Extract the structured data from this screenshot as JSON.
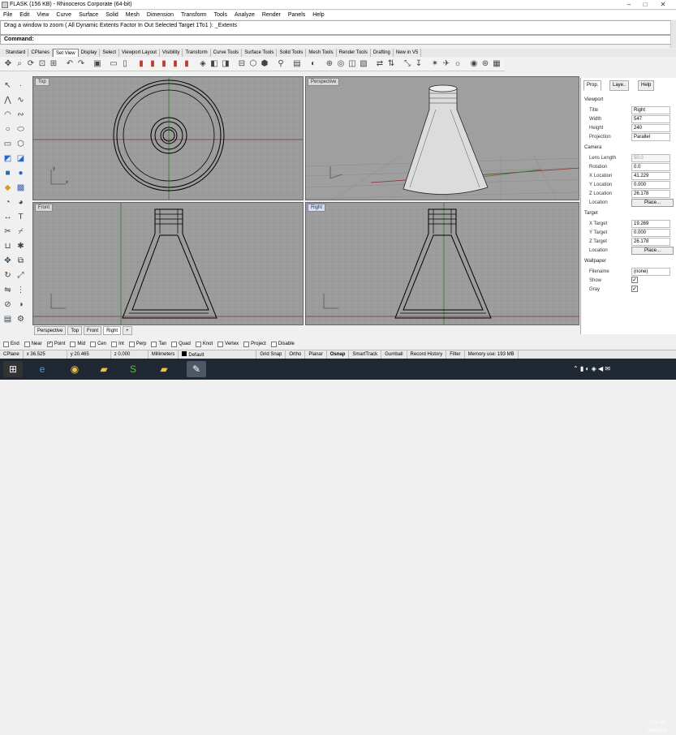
{
  "window": {
    "title": "FLASK (156 KB) - Rhinoceros Corporate (64-bit)"
  },
  "menu": [
    "File",
    "Edit",
    "View",
    "Curve",
    "Surface",
    "Solid",
    "Mesh",
    "Dimension",
    "Transform",
    "Tools",
    "Analyze",
    "Render",
    "Panels",
    "Help"
  ],
  "command": {
    "history": "Drag a window to zoom ( All  Dynamic  Extents  Factor  In  Out  Selected  Target  1To1 ): _Extents",
    "prompt": "Command:"
  },
  "toolbar_tabs": [
    "Standard",
    "CPlanes",
    "Set View",
    "Display",
    "Select",
    "Viewport Layout",
    "Visibility",
    "Transform",
    "Curve Tools",
    "Surface Tools",
    "Solid Tools",
    "Mesh Tools",
    "Render Tools",
    "Drafting",
    "New in V5"
  ],
  "active_toolbar_tab": "Set View",
  "viewports": {
    "top": "Top",
    "perspective": "Perspective",
    "front": "Front",
    "right": "Right"
  },
  "viewport_tabs": [
    "Perspective",
    "Top",
    "Front",
    "Right"
  ],
  "active_viewport_tab": "Right",
  "panel": {
    "tabs": [
      "Prop.",
      "Laye..",
      "Help"
    ],
    "section_viewport": "Viewport",
    "title_label": "Title",
    "title_value": "Right",
    "width_label": "Width",
    "width_value": "547",
    "height_label": "Height",
    "height_value": "240",
    "projection_label": "Projection",
    "projection_value": "Parallel",
    "section_camera": "Camera",
    "lens_label": "Lens Length",
    "lens_value": "50.0",
    "rotation_label": "Rotation",
    "rotation_value": "0.0",
    "xloc_label": "X Location",
    "xloc_value": "41.229",
    "yloc_label": "Y Location",
    "yloc_value": "0.000",
    "zloc_label": "Z Location",
    "zloc_value": "26.178",
    "location_label": "Location",
    "place_label": "Place...",
    "section_target": "Target",
    "xt_label": "X Target",
    "xt_value": "19.269",
    "yt_label": "Y Target",
    "yt_value": "0.000",
    "zt_label": "Z Target",
    "zt_value": "26.178",
    "tlocation_label": "Location",
    "tplace_label": "Place...",
    "section_wallpaper": "Wallpaper",
    "filename_label": "Filename",
    "filename_value": "(none)",
    "show_label": "Show",
    "gray_label": "Gray"
  },
  "osnaps": [
    {
      "label": "End",
      "checked": false
    },
    {
      "label": "Near",
      "checked": false
    },
    {
      "label": "Point",
      "checked": true
    },
    {
      "label": "Mid",
      "checked": false
    },
    {
      "label": "Cen",
      "checked": false
    },
    {
      "label": "Int",
      "checked": false
    },
    {
      "label": "Perp",
      "checked": false
    },
    {
      "label": "Tan",
      "checked": false
    },
    {
      "label": "Quad",
      "checked": false
    },
    {
      "label": "Knot",
      "checked": false
    },
    {
      "label": "Vertex",
      "checked": false
    },
    {
      "label": "Project",
      "checked": false
    },
    {
      "label": "Disable",
      "checked": false
    }
  ],
  "status": {
    "cplane": "CPlane",
    "x": "x 36.525",
    "y": "y 20.465",
    "z": "z 0.000",
    "units": "Millimeters",
    "layer": "Default",
    "grid_snap": "Grid Snap",
    "ortho": "Ortho",
    "planar": "Planar",
    "osnap": "Osnap",
    "smarttrack": "SmartTrack",
    "gumball": "Gumball",
    "record_history": "Record History",
    "filter": "Filter",
    "memory": "Memory use: 193 MB"
  },
  "clock": {
    "time": "2:14 AM",
    "date": "3/4/2016"
  }
}
